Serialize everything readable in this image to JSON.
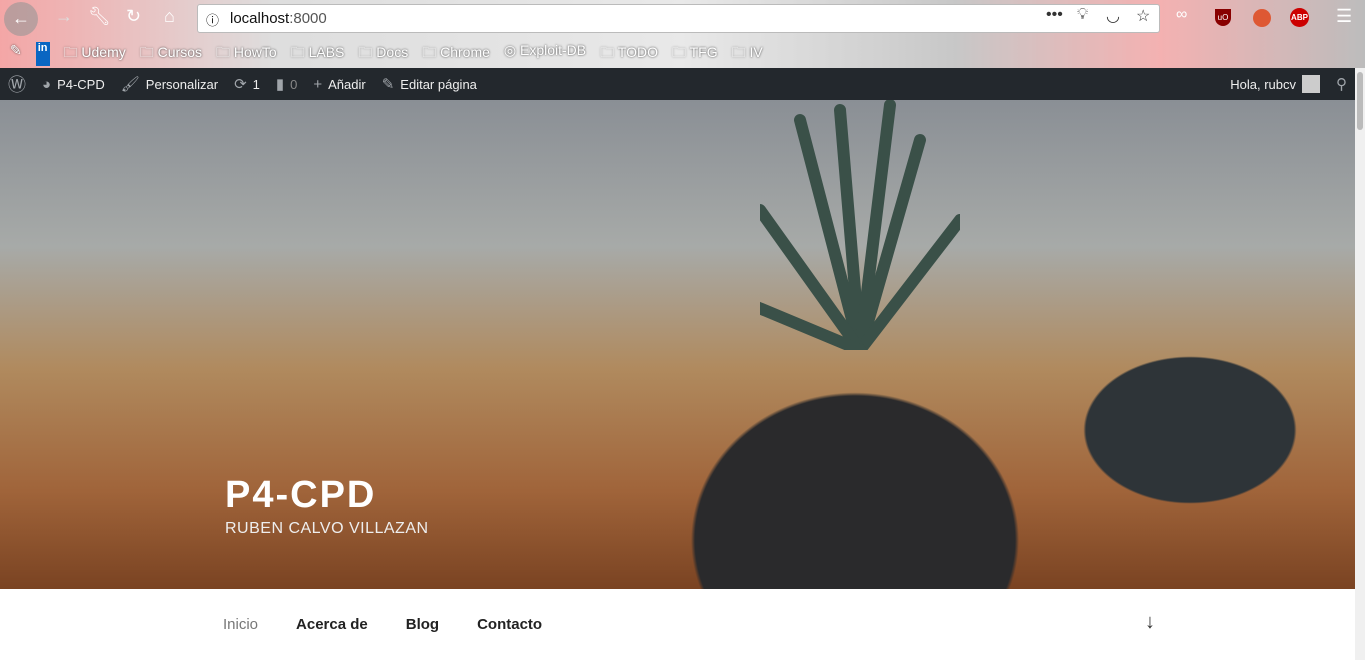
{
  "browser": {
    "url_host": "localhost",
    "url_port": ":8000",
    "bookmarks": [
      "Udemy",
      "Cursos",
      "HowTo",
      "LABS",
      "Docs",
      "Chrome",
      "Exploit-DB",
      "TODO",
      "TFG",
      "IV"
    ],
    "extensions": [
      "ublock-origin",
      "duckduckgo",
      "adblock-plus"
    ]
  },
  "adminbar": {
    "site": "P4-CPD",
    "customize": "Personalizar",
    "updates": "1",
    "comments": "0",
    "add": "Añadir",
    "edit": "Editar página",
    "greeting": "Hola, rubcv"
  },
  "site": {
    "title": "P4-CPD",
    "description": "RUBEN CALVO VILLAZAN"
  },
  "nav": {
    "items": [
      "Inicio",
      "Acerca de",
      "Blog",
      "Contacto"
    ]
  }
}
